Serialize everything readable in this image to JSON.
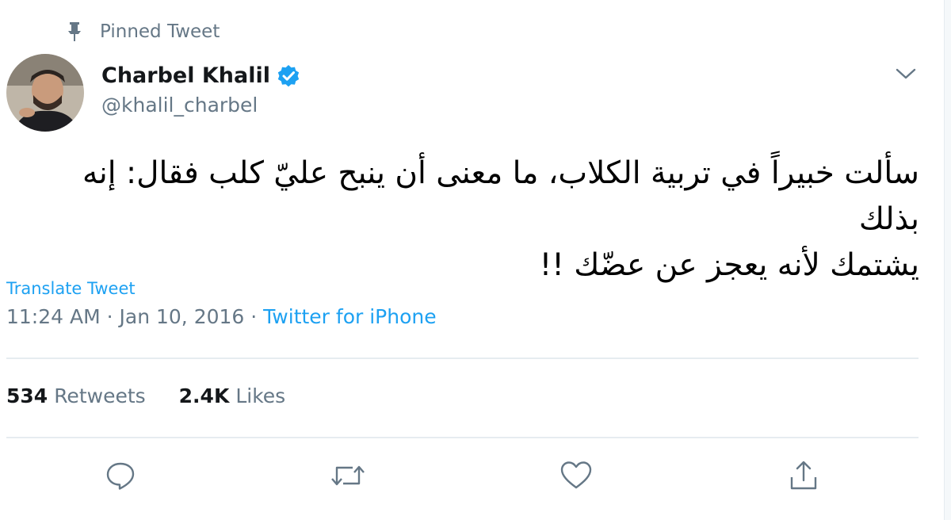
{
  "pinned": {
    "label": "Pinned Tweet",
    "icon": "pin-icon"
  },
  "author": {
    "name": "Charbel Khalil",
    "handle": "@khalil_charbel",
    "verified": true,
    "verified_icon": "verified-badge-icon",
    "avatar_icon": "avatar"
  },
  "menu": {
    "icon": "chevron-down-icon"
  },
  "tweet": {
    "text_line_1": "سألت خبيراً في تربية الكلاب، ما معنى أن ينبح عليّ كلب فقال: إنه بذلك",
    "text_line_2": "يشتمك لأنه يعجز عن عضّك !!"
  },
  "translate": {
    "label": "Translate Tweet"
  },
  "meta": {
    "time": "11:24 AM",
    "separator": " · ",
    "date": "Jan 10, 2016",
    "source": "Twitter for iPhone"
  },
  "stats": {
    "retweets_count": "534",
    "retweets_label": "Retweets",
    "likes_count": "2.4K",
    "likes_label": "Likes"
  },
  "actions": [
    {
      "name": "reply",
      "icon": "reply-icon"
    },
    {
      "name": "retweet",
      "icon": "retweet-icon"
    },
    {
      "name": "like",
      "icon": "heart-icon"
    },
    {
      "name": "share",
      "icon": "share-icon"
    }
  ],
  "colors": {
    "accent": "#1da1f2",
    "secondary_text": "#657786",
    "primary_text": "#14171a",
    "divider": "#e6ecf0"
  }
}
